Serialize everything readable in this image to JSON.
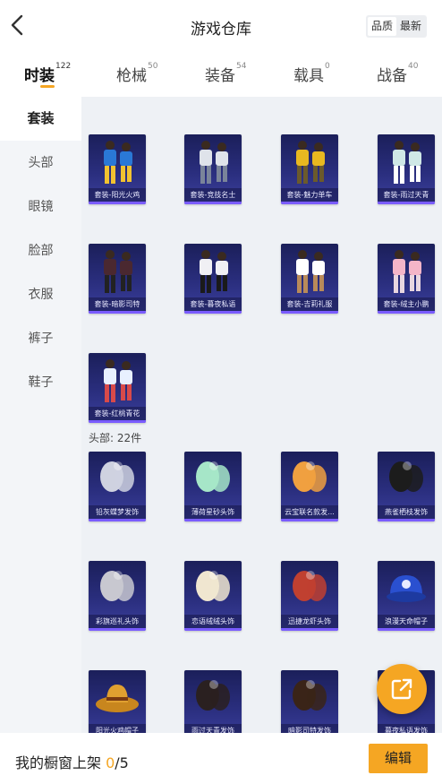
{
  "header": {
    "title": "游戏仓库",
    "sort_options": [
      "品质",
      "最新"
    ],
    "active_sort": "品质"
  },
  "tabs": [
    {
      "label": "时装",
      "count": "122",
      "active": true
    },
    {
      "label": "枪械",
      "count": "50",
      "active": false
    },
    {
      "label": "装备",
      "count": "54",
      "active": false
    },
    {
      "label": "载具",
      "count": "0",
      "active": false
    },
    {
      "label": "战备",
      "count": "40",
      "active": false
    }
  ],
  "sidebar": {
    "items": [
      "套装",
      "头部",
      "眼镜",
      "脸部",
      "衣服",
      "裤子",
      "鞋子"
    ],
    "active": "套装"
  },
  "suits": [
    {
      "label": "套装-阳光火鸡",
      "icon": "outfit-icon"
    },
    {
      "label": "套装-竞技名士",
      "icon": "outfit-icon"
    },
    {
      "label": "套装-魅力单车",
      "icon": "outfit-icon"
    },
    {
      "label": "套装-雨过天青",
      "icon": "outfit-icon"
    },
    {
      "label": "套装-暗影司特",
      "icon": "outfit-icon"
    },
    {
      "label": "套装-暮夜私语",
      "icon": "outfit-icon"
    },
    {
      "label": "套装-吉莉礼服",
      "icon": "outfit-icon"
    },
    {
      "label": "套装-绒主小鹏",
      "icon": "outfit-icon"
    },
    {
      "label": "套装-红桃青花",
      "icon": "outfit-icon"
    }
  ],
  "head_section": {
    "label": "头部: 22件",
    "items": [
      {
        "label": "铅灰蝶梦发饰",
        "icon": "hair-accessory-icon"
      },
      {
        "label": "薄荷星砂头饰",
        "icon": "hair-accessory-icon"
      },
      {
        "label": "云宝联名款发...",
        "icon": "hair-accessory-icon"
      },
      {
        "label": "燕雀栖枝发饰",
        "icon": "hair-accessory-icon"
      },
      {
        "label": "彩旗巡礼头饰",
        "icon": "headwear-icon"
      },
      {
        "label": "恋语绒绒头饰",
        "icon": "headwear-icon"
      },
      {
        "label": "迅捷龙虾头饰",
        "icon": "headwear-icon"
      },
      {
        "label": "浪漫天命帽子",
        "icon": "cap-icon"
      },
      {
        "label": "阳光火鸡帽子",
        "icon": "hat-icon"
      },
      {
        "label": "雨过天青发饰",
        "icon": "hair-accessory-icon"
      },
      {
        "label": "暗影司特发饰",
        "icon": "hair-accessory-icon"
      },
      {
        "label": "暮夜私语发饰",
        "icon": "hair-accessory-icon"
      }
    ]
  },
  "footer": {
    "text": "我的橱窗上架 ",
    "current": "0",
    "total": "/5",
    "edit_label": "编辑"
  },
  "colors": {
    "accent": "#f5a623",
    "card_bg": "#2a2e7e",
    "card_bar": "#7a5cff",
    "sidebar_bg": "#f3f5f8",
    "content_bg": "#eef1f5"
  }
}
